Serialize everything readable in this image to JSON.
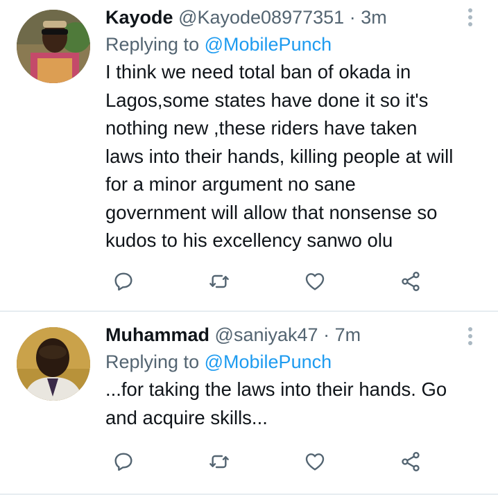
{
  "tweets": [
    {
      "name": "Kayode",
      "handle": "@Kayode08977351",
      "separator": "·",
      "time": "3m",
      "replying_prefix": "Replying to",
      "replying_to": "@MobilePunch",
      "text": "I think we need total ban of okada in Lagos,some states have done it so it's nothing new ,these riders have taken laws into their hands, killing people at will for a minor argument no sane government will allow that nonsense so kudos to his excellency sanwo olu"
    },
    {
      "name": "Muhammad",
      "handle": "@saniyak47",
      "separator": "·",
      "time": "7m",
      "replying_prefix": "Replying to",
      "replying_to": "@MobilePunch",
      "text": "...for taking the laws into their hands. Go and acquire skills..."
    }
  ],
  "icons": {
    "reply": "reply-icon",
    "retweet": "retweet-icon",
    "like": "heart-icon",
    "share": "share-icon",
    "more": "more-vertical-icon"
  },
  "colors": {
    "link": "#1d9bf0",
    "secondary_text": "#536471",
    "icon": "#536471",
    "divider": "#e6ecf0"
  }
}
